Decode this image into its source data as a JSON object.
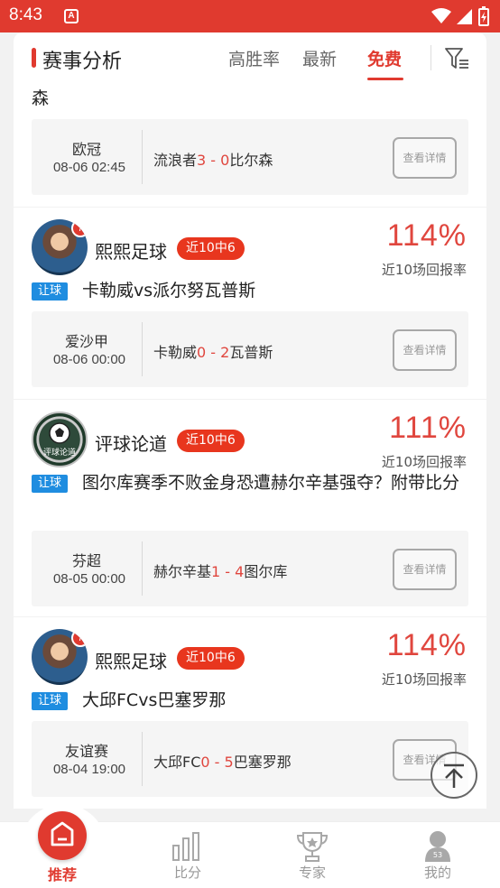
{
  "status_bar": {
    "time": "8:43",
    "notification_icon": "A"
  },
  "header": {
    "title": "赛事分析",
    "tabs": [
      {
        "label": "高胜率",
        "active": false
      },
      {
        "label": "最新",
        "active": false
      },
      {
        "label": "免费",
        "active": true
      }
    ],
    "filter_icon": "filter-icon"
  },
  "posts": [
    {
      "title_tail": "森",
      "match": {
        "league": "欧冠",
        "time": "08-06 02:45",
        "home": "流浪者",
        "score": "3 - 0",
        "away": "比尔森",
        "detail_label": "查看详情"
      }
    },
    {
      "author": "熙熙足球",
      "badge": "7",
      "streak": "近10中6",
      "rate": "114%",
      "rate_label": "近10场回报率",
      "tag": "让球",
      "title": "卡勒威vs派尔努瓦普斯",
      "match": {
        "league": "爱沙甲",
        "time": "08-06 00:00",
        "home": "卡勒威",
        "score": "0 - 2",
        "away": "瓦普斯",
        "detail_label": "查看详情"
      }
    },
    {
      "author": "评球论道",
      "streak": "近10中6",
      "rate": "111%",
      "rate_label": "近10场回报率",
      "tag": "让球",
      "title": "图尔库赛季不败金身恐遭赫尔辛基强夺？附带比分",
      "match": {
        "league": "芬超",
        "time": "08-05 00:00",
        "home": "赫尔辛基",
        "score": "1 - 4",
        "away": "图尔库",
        "detail_label": "查看详情"
      }
    },
    {
      "author": "熙熙足球",
      "badge": "7",
      "streak": "近10中6",
      "rate": "114%",
      "rate_label": "近10场回报率",
      "tag": "让球",
      "title": "大邱FCvs巴塞罗那",
      "match": {
        "league": "友谊赛",
        "time": "08-04 19:00",
        "home": "大邱FC",
        "score": "0 - 5",
        "away": "巴塞罗那",
        "detail_label": "查看详情"
      }
    }
  ],
  "avatar_logo_text": "评球论道",
  "bottom_nav": [
    {
      "label": "推荐",
      "icon": "home-icon",
      "active": true
    },
    {
      "label": "比分",
      "icon": "bar-chart-icon",
      "active": false
    },
    {
      "label": "专家",
      "icon": "trophy-icon",
      "active": false
    },
    {
      "label": "我的",
      "icon": "user-icon",
      "active": false,
      "icon_text": "53"
    }
  ],
  "colors": {
    "brand": "#e03a2f",
    "tag_blue": "#1f8de0",
    "rate_red": "#e0463e",
    "streak_red": "#e8361e"
  }
}
